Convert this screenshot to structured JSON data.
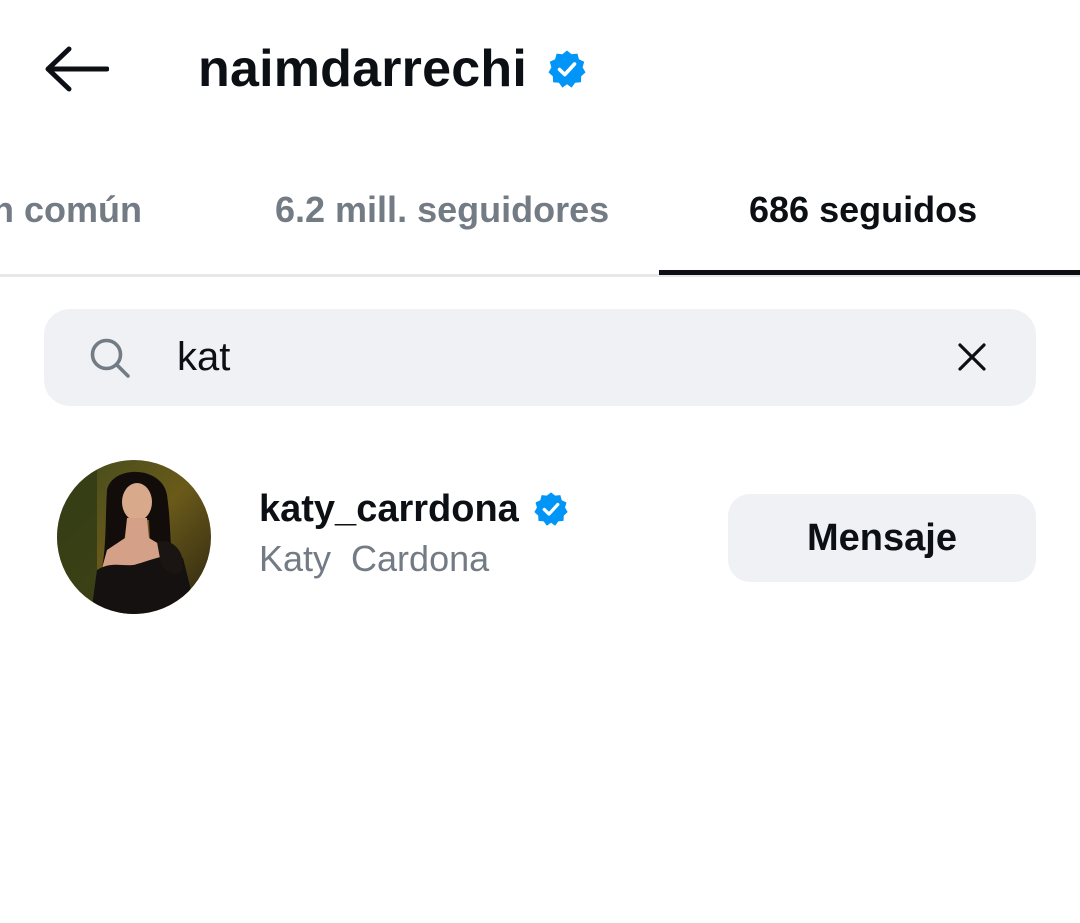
{
  "header": {
    "back_icon": "arrow-left-icon",
    "title": "naimdarrechi",
    "verified_icon": "verified-badge-icon"
  },
  "tabs": [
    {
      "label": "n común",
      "active": false
    },
    {
      "label": "6.2 mill. seguidores",
      "active": false
    },
    {
      "label": "686 seguidos",
      "active": true
    }
  ],
  "search": {
    "icon": "search-icon",
    "value": "kat",
    "clear_icon": "close-icon"
  },
  "results": [
    {
      "username": "katy_carrdona",
      "verified": true,
      "full_name": "Katy  Cardona",
      "action_label": "Mensaje"
    }
  ],
  "colors": {
    "verified_blue": "#0095f6",
    "muted_text": "#737b85",
    "surface": "#eff1f4",
    "text": "#0c1014"
  }
}
